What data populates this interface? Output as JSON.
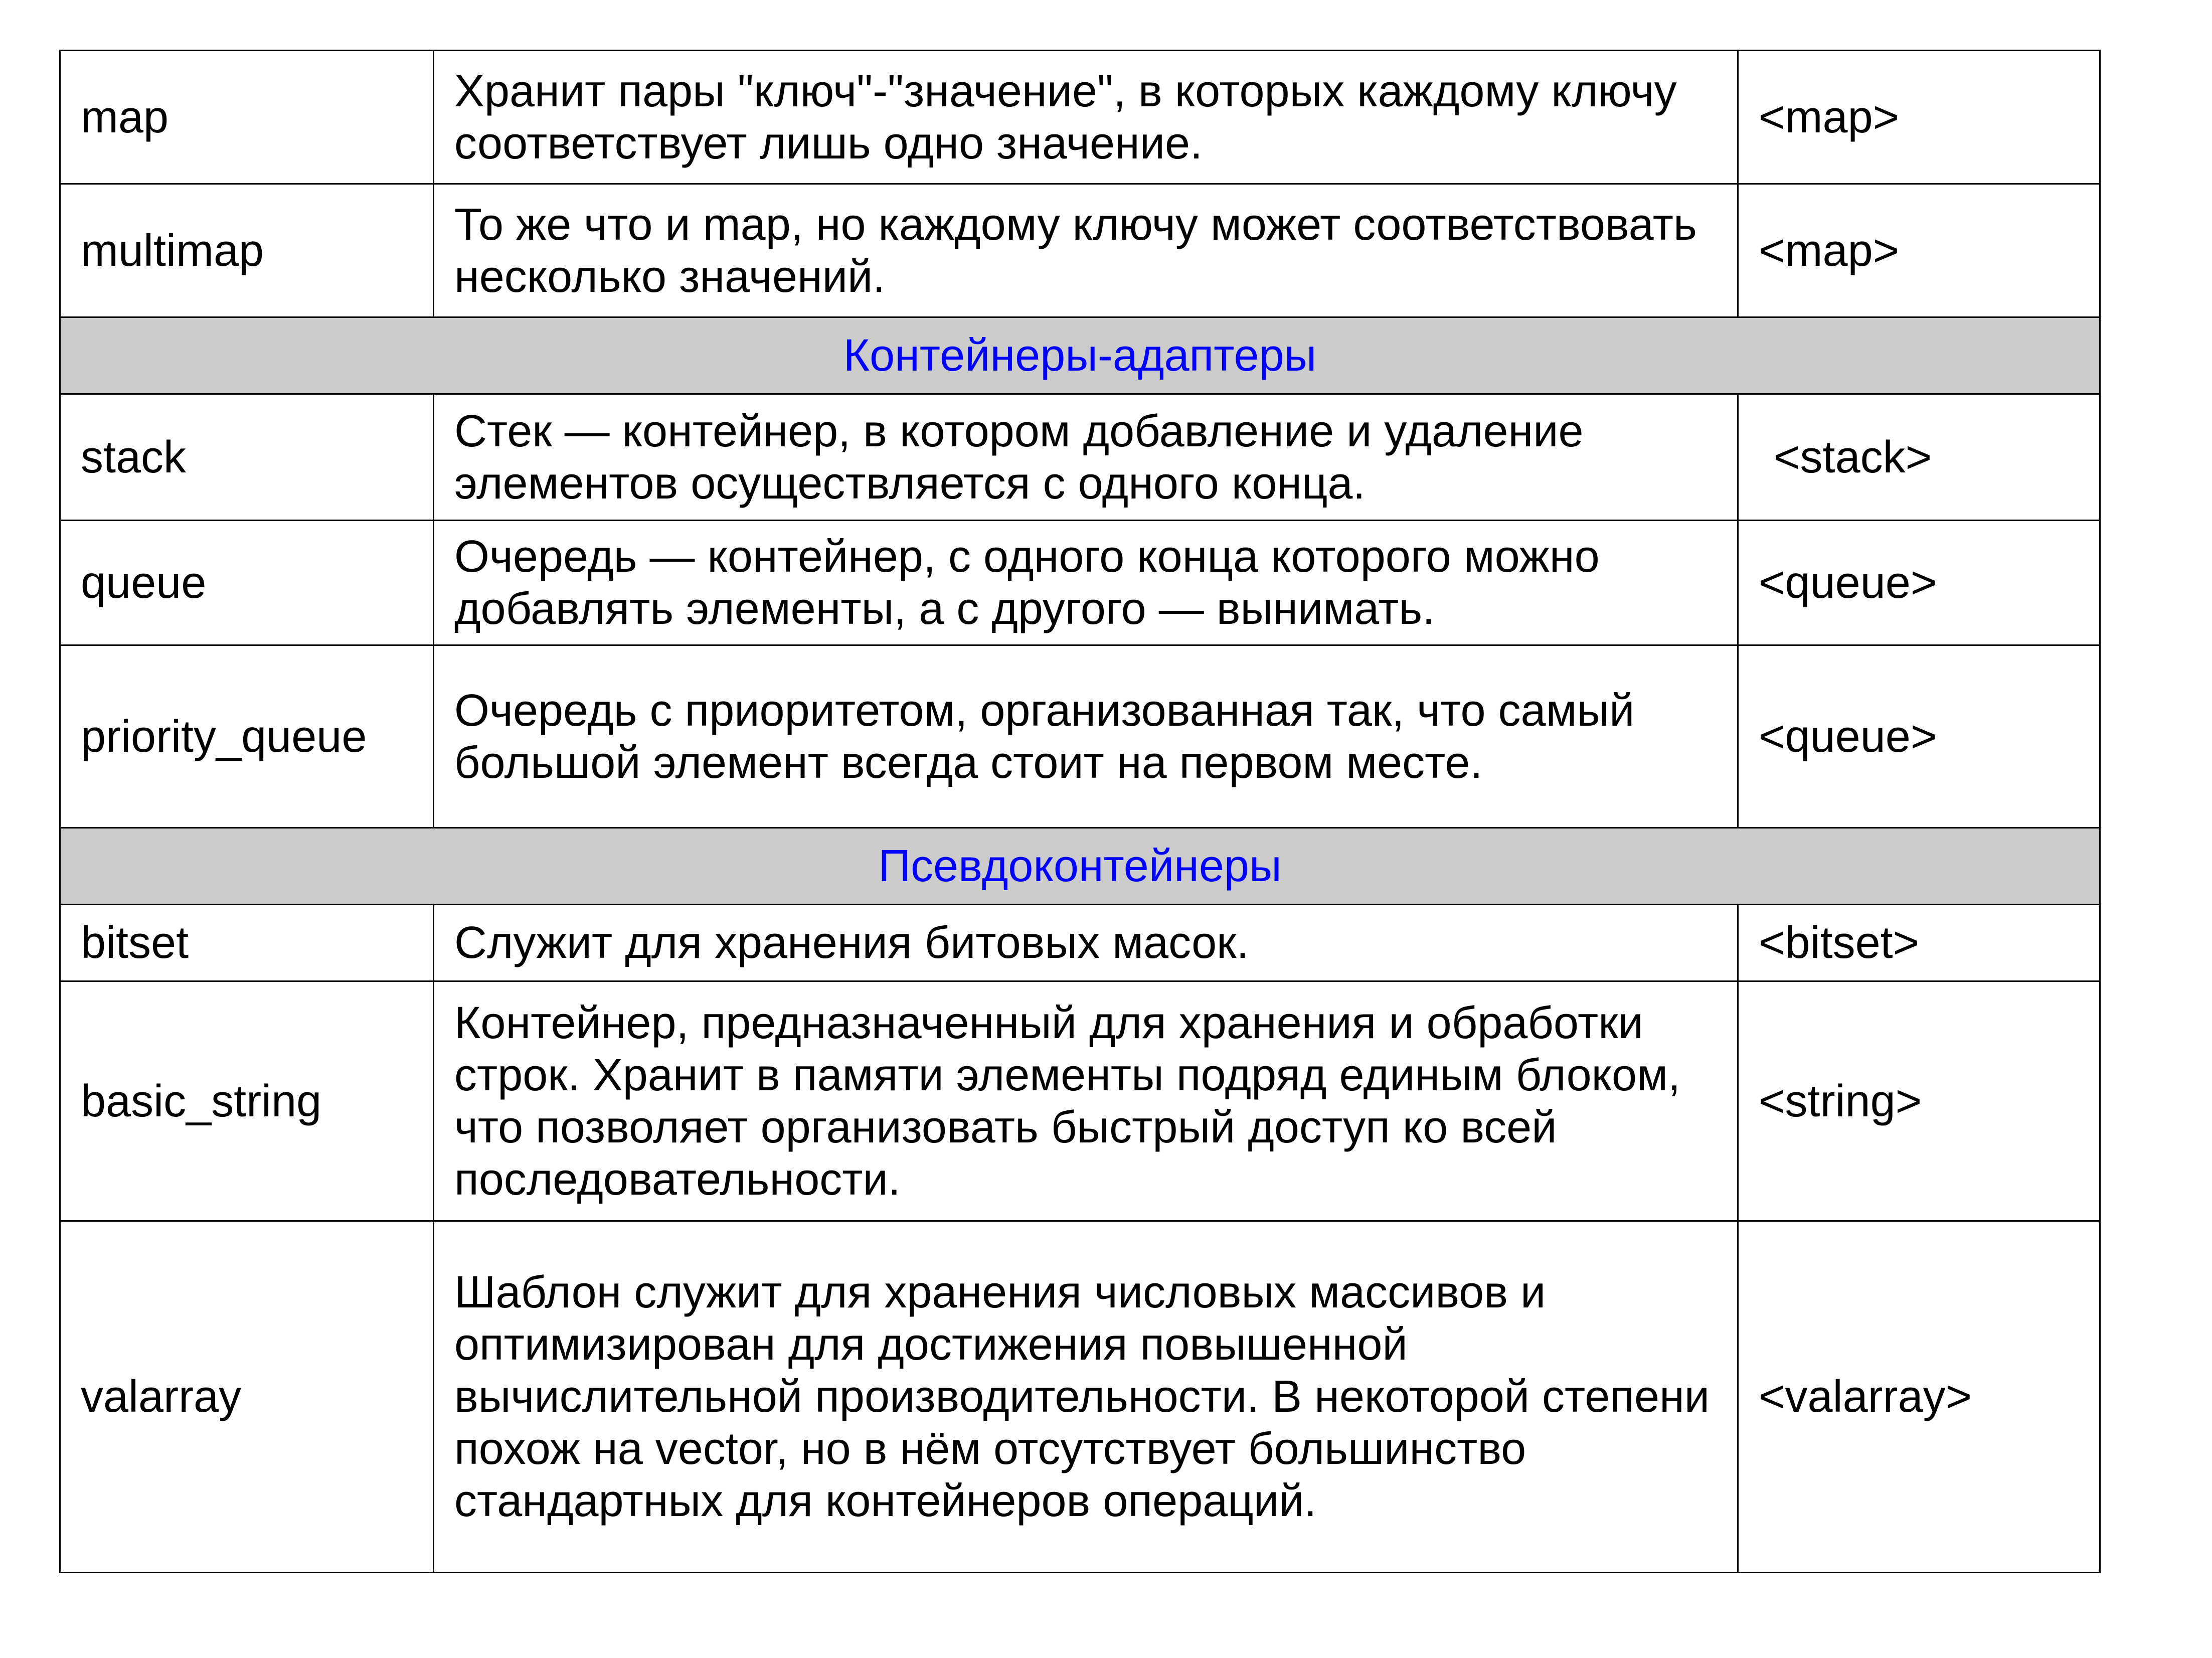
{
  "table": {
    "rows": [
      {
        "type": "row",
        "name": "map",
        "description": "Хранит пары \"ключ\"-\"значение\", в которых каждому ключу соответствует лишь одно значение.",
        "header": "<map>"
      },
      {
        "type": "row",
        "name": "multimap",
        "description": "То же что и map, но каждому ключу может соответствовать несколько значений.",
        "header": "<map>"
      },
      {
        "type": "section",
        "title": "Контейнеры-адаптеры"
      },
      {
        "type": "row",
        "name": "stack",
        "description": "Стек — контейнер, в котором добавление и удаление элементов осуществляется с одного конца.",
        "header": " <stack>"
      },
      {
        "type": "row",
        "name": "queue",
        "description": "Очередь — контейнер, с одного конца которого можно добавлять элементы, а с другого — вынимать.",
        "header": "<queue>"
      },
      {
        "type": "row",
        "name": "priority_queue",
        "description": "Очередь с приоритетом, организованная так, что самый большой элемент всегда стоит на первом месте.",
        "header": "<queue>"
      },
      {
        "type": "section",
        "title": "Псевдоконтейнеры"
      },
      {
        "type": "row",
        "name": "bitset",
        "description": "Служит для хранения битовых масок.",
        "header": "<bitset>"
      },
      {
        "type": "row",
        "name": "basic_string",
        "description": "Контейнер, предназначенный для хранения и обработки строк. Хранит в памяти элементы подряд единым блоком, что позволяет организовать быстрый доступ ко всей последовательности.",
        "header": "<string>"
      },
      {
        "type": "row",
        "name": "valarray",
        "description": "Шаблон служит для хранения числовых массивов и оптимизирован для достижения повышенной вычислительной производительности. В некоторой степени похож на vector, но в нём отсутствует большинство стандартных для контейнеров операций.",
        "header": "<valarray>"
      }
    ]
  },
  "colors": {
    "section_background": "#cccccc",
    "section_text": "#0000ff",
    "text": "#000000",
    "border": "#000000"
  }
}
